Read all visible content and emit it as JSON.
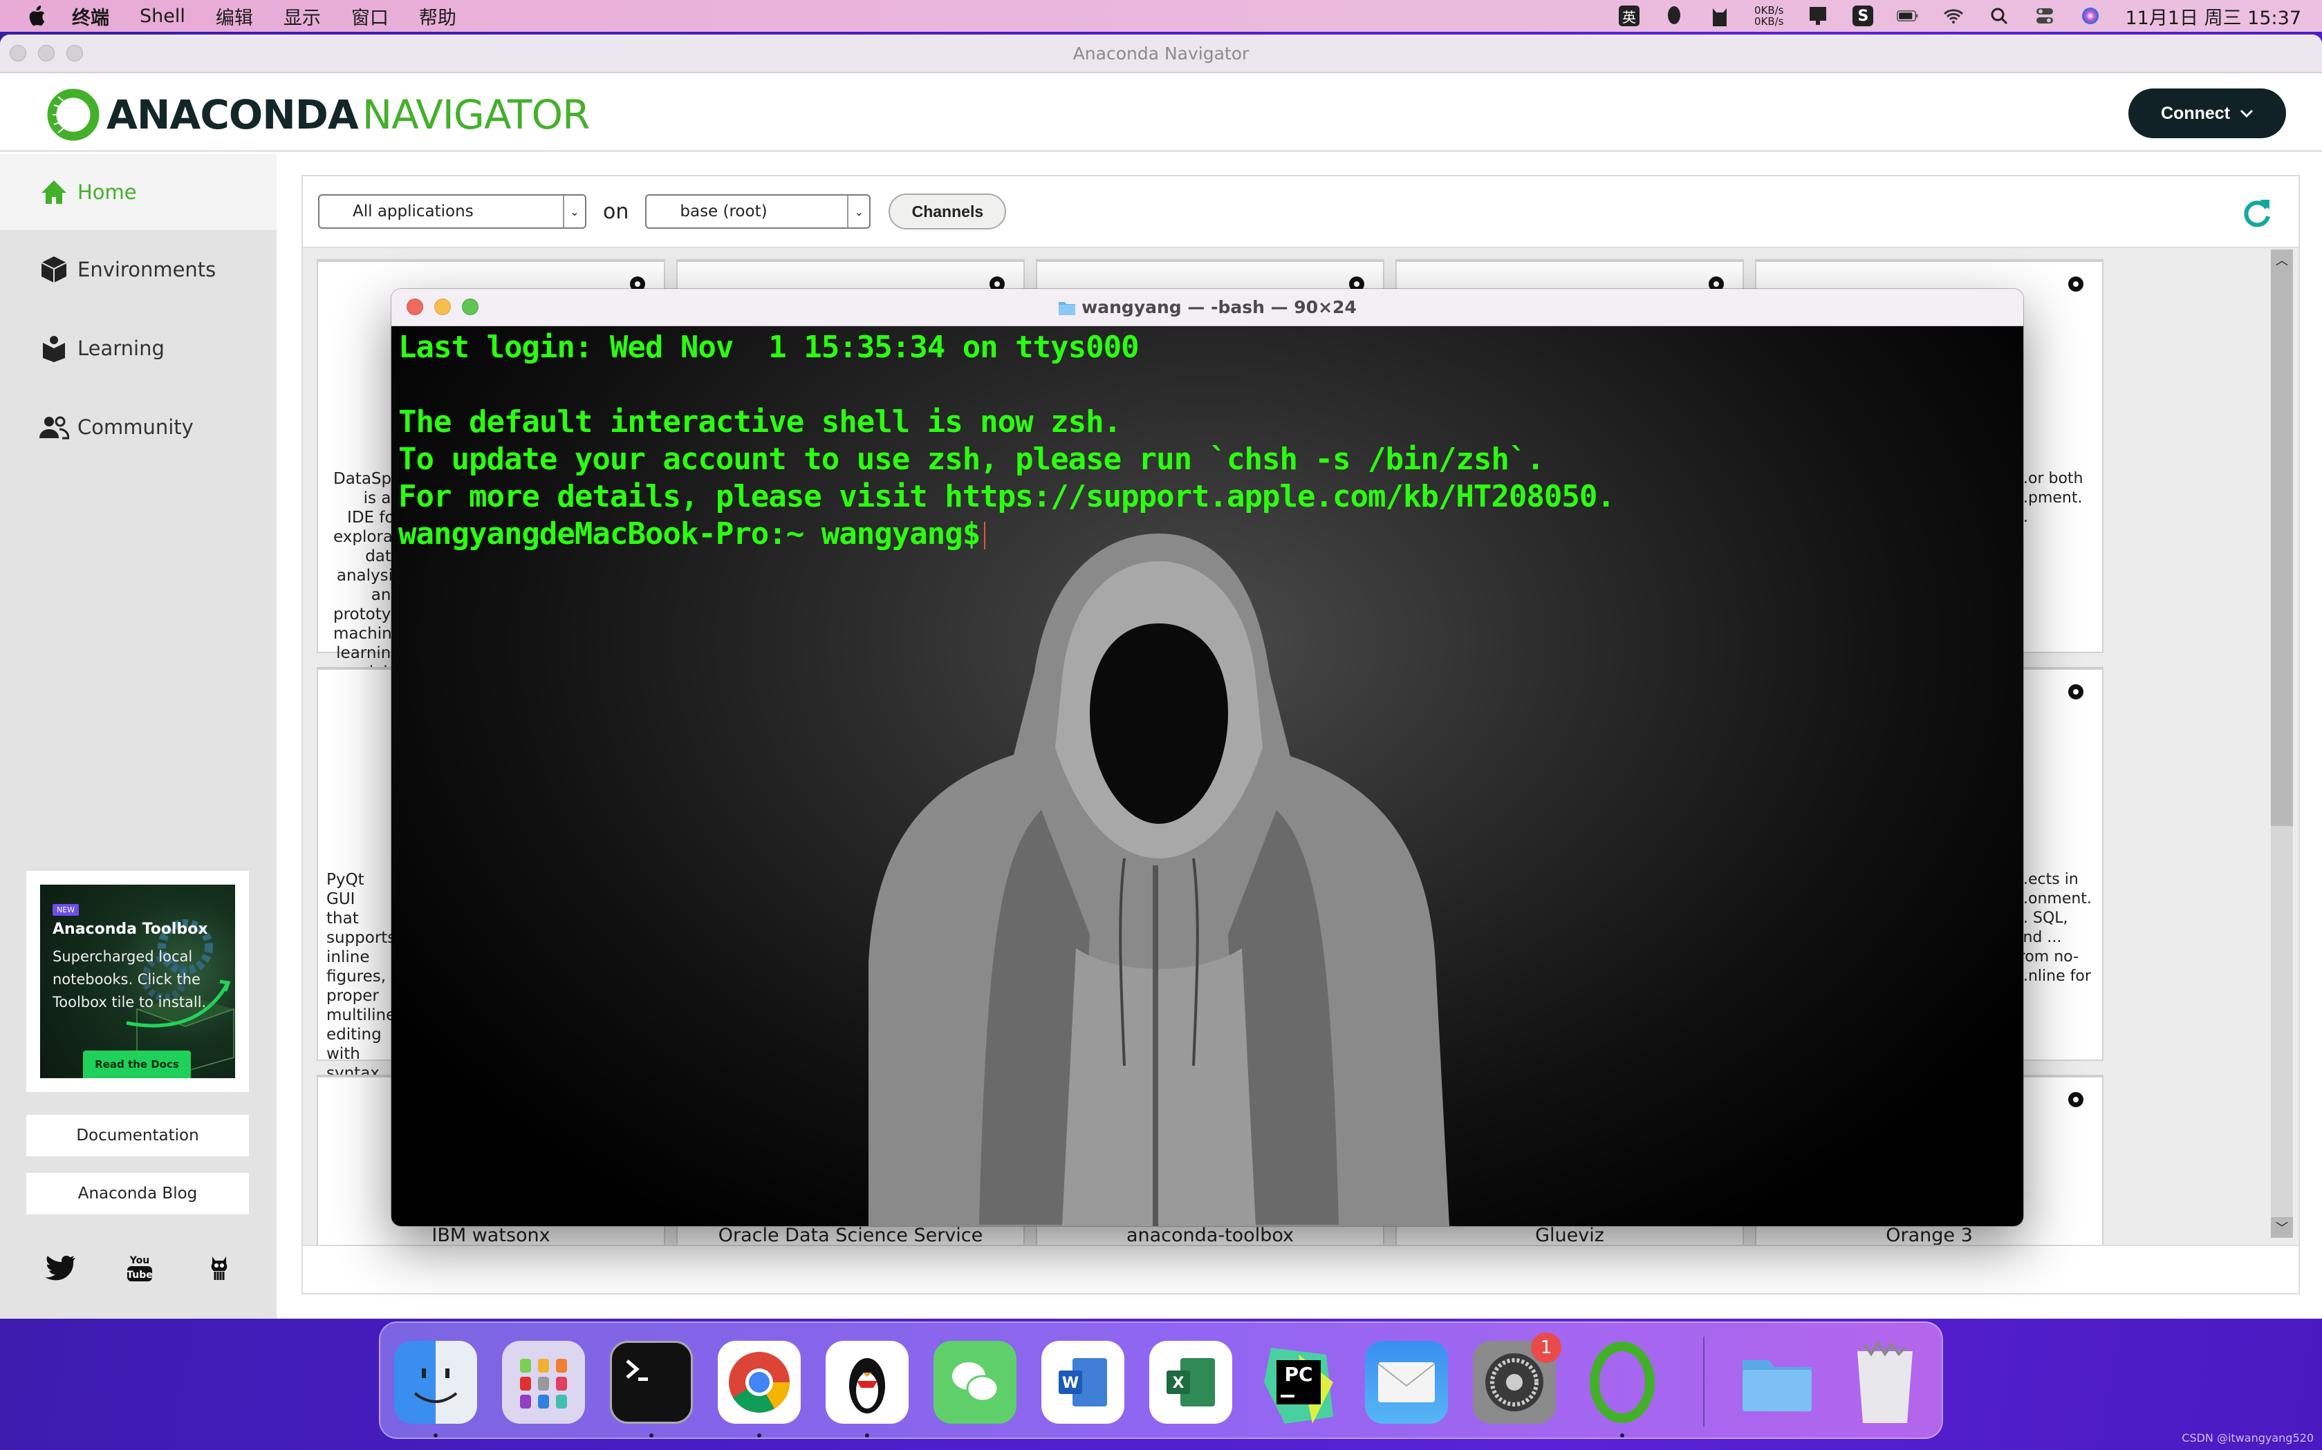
{
  "menubar": {
    "app_name": "终端",
    "items": [
      "Shell",
      "编辑",
      "显示",
      "窗口",
      "帮助"
    ],
    "status": {
      "input_method": "英",
      "net_up": "0KB/s",
      "net_down": "0KB/s",
      "clock": "11月1日 周三  15:37"
    }
  },
  "anaconda": {
    "window_title": "Anaconda Navigator",
    "logo_word1": "ANACONDA",
    "logo_word2": "NAVIGATOR",
    "connect_label": "Connect",
    "nav": [
      {
        "label": "Home",
        "icon": "home-icon",
        "active": true
      },
      {
        "label": "Environments",
        "icon": "cube-icon",
        "active": false
      },
      {
        "label": "Learning",
        "icon": "book-icon",
        "active": false
      },
      {
        "label": "Community",
        "icon": "people-icon",
        "active": false
      }
    ],
    "promo": {
      "badge": "NEW",
      "title": "Anaconda Toolbox",
      "text": "Supercharged local notebooks. Click the Toolbox tile to install.",
      "button": "Read the Docs"
    },
    "links": [
      "Documentation",
      "Anaconda Blog"
    ],
    "filter": {
      "applications_value": "All applications",
      "on_label": "on",
      "environment_value": "base (root)",
      "channels_label": "Channels"
    },
    "tiles_row1_desc": [
      "DataSpell is an IDE for exploratory data analysis and prototyping machine learning models. It combines the interactivity of Jupyter notebooks with the intelligent Python and R coding assistance of PyCharm in one user-friendly environment.",
      "",
      "",
      "",
      "...or both ...pment. ..."
    ],
    "tiles_row2_desc": [
      "PyQt GUI that supports inline figures, proper multiline editing with syntax highlighting, graphical calltips, and more.",
      "",
      "",
      "",
      "...ects in ...onment. ... SQL, and ... from no- ...nline for"
    ],
    "tiles_row3_names": [
      "IBM watsonx",
      "Oracle Data Science Service",
      "anaconda-toolbox",
      "Glueviz",
      "Orange 3"
    ]
  },
  "terminal": {
    "title": "wangyang — -bash — 90×24",
    "lines": [
      "Last login: Wed Nov  1 15:35:34 on ttys000",
      "",
      "The default interactive shell is now zsh.",
      "To update your account to use zsh, please run `chsh -s /bin/zsh`.",
      "For more details, please visit https://support.apple.com/kb/HT208050."
    ],
    "prompt": "wangyangdeMacBook-Pro:~ wangyang$",
    "text_color": "#2bff10"
  },
  "dock": {
    "apps": [
      "Finder",
      "Launchpad",
      "Terminal",
      "Chrome",
      "QQ",
      "WeChat",
      "Word",
      "Excel",
      "PyCharm",
      "Mail",
      "System Preferences",
      "Anaconda Navigator"
    ],
    "system_prefs_badge": "1",
    "others": [
      "Downloads Folder",
      "Trash"
    ]
  },
  "watermark": "CSDN @itwangyang520"
}
